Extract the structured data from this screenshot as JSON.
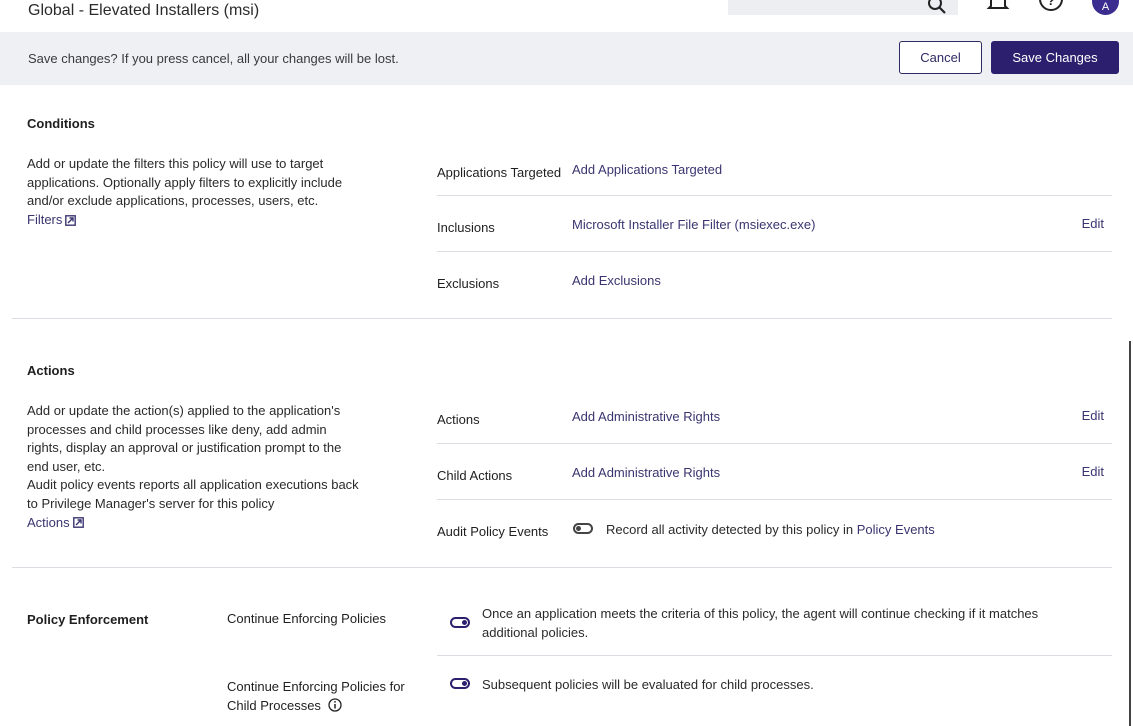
{
  "header": {
    "title": "Global - Elevated Installers (msi)",
    "avatar_initial": "A",
    "icons": [
      "search-icon",
      "bell-icon",
      "help-icon"
    ]
  },
  "savebar": {
    "message": "Save changes? If you press cancel, all your changes will be lost.",
    "cancel_label": "Cancel",
    "save_label": "Save Changes"
  },
  "conditions": {
    "title": "Conditions",
    "description": "Add or update the filters this policy will use to target applications. Optionally apply filters to explicitly include and/or exclude applications, processes, users, etc.",
    "link_label": "Filters",
    "rows": [
      {
        "label": "Applications Targeted",
        "value": "Add Applications Targeted",
        "edit": ""
      },
      {
        "label": "Inclusions",
        "value": "Microsoft Installer File Filter (msiexec.exe)",
        "edit": "Edit"
      },
      {
        "label": "Exclusions",
        "value": "Add Exclusions",
        "edit": ""
      }
    ]
  },
  "actions": {
    "title": "Actions",
    "description": "Add or update the action(s) applied to the application's processes and child processes like deny, add admin rights, display an approval or justification prompt to the end user, etc.",
    "description2": "Audit policy events reports all application executions back to Privilege Manager's server for this policy",
    "link_label": "Actions",
    "rows": [
      {
        "label": "Actions",
        "value": "Add Administrative Rights",
        "edit": "Edit"
      },
      {
        "label": "Child Actions",
        "value": "Add Administrative Rights",
        "edit": "Edit"
      }
    ],
    "audit": {
      "label": "Audit Policy Events",
      "text_prefix": "Record all activity detected by this policy in ",
      "link": "Policy Events",
      "enabled": false
    }
  },
  "enforcement": {
    "title": "Policy Enforcement",
    "rows": [
      {
        "label": "Continue Enforcing Policies",
        "text": "Once an application meets the criteria of this policy, the agent will continue checking if it matches additional policies.",
        "enabled": true
      },
      {
        "label": "Continue Enforcing Policies for Child Processes",
        "text": "Subsequent policies will be evaluated for child processes.",
        "enabled": true
      }
    ]
  },
  "colors": {
    "accent": "#2b1f6e",
    "link": "#3a3570",
    "savebar_bg": "#eef0f4",
    "divider": "#dcdde2"
  }
}
